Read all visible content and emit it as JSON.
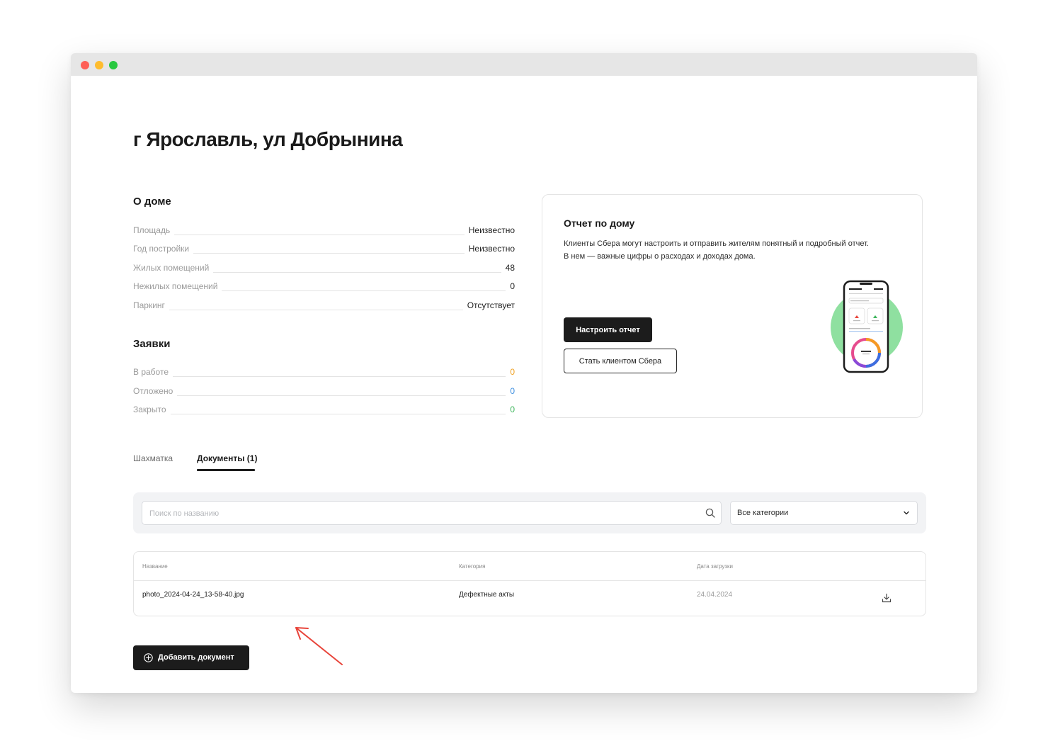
{
  "window": {
    "traffic_lights": [
      "close",
      "minimize",
      "zoom"
    ]
  },
  "page": {
    "title": "г Ярославль, ул Добрынина"
  },
  "about_house": {
    "title": "О доме",
    "rows": [
      {
        "label": "Площадь",
        "value": "Неизвестно"
      },
      {
        "label": "Год постройки",
        "value": "Неизвестно"
      },
      {
        "label": "Жилых помещений",
        "value": "48"
      },
      {
        "label": "Нежилых помещений",
        "value": "0"
      },
      {
        "label": "Паркинг",
        "value": "Отсутствует"
      }
    ]
  },
  "requests": {
    "title": "Заявки",
    "rows": [
      {
        "label": "В работе",
        "value": "0",
        "color": "#f0a020"
      },
      {
        "label": "Отложено",
        "value": "0",
        "color": "#3d8fe0"
      },
      {
        "label": "Закрыто",
        "value": "0",
        "color": "#3cb55a"
      }
    ]
  },
  "report_card": {
    "title": "Отчет по дому",
    "description_lines": [
      "Клиенты Сбера могут настроить и отправить жителям понятный и подробный отчет.",
      "В нем — важные цифры о расходах и доходах дома."
    ],
    "primary_button": "Настроить отчет",
    "secondary_button": "Стать клиентом Сбера",
    "illustration": "phone-report-icon",
    "accent_color": "#8fe0a0"
  },
  "tabs": [
    {
      "label": "Шахматка",
      "active": false
    },
    {
      "label": "Документы (1)",
      "active": true
    }
  ],
  "filters": {
    "search_placeholder": "Поиск по названию",
    "category_selected": "Все категории"
  },
  "documents_table": {
    "headers": {
      "name": "Название",
      "category": "Категория",
      "date": "Дата загрузки"
    },
    "rows": [
      {
        "name": "photo_2024-04-24_13-58-40.jpg",
        "category": "Дефектные акты",
        "date": "24.04.2024"
      }
    ]
  },
  "add_document_button": "Добавить документ",
  "colors": {
    "primary_dark": "#1c1c1c",
    "annotation_arrow": "#e8443a",
    "date_text": "#9b9b9b"
  }
}
